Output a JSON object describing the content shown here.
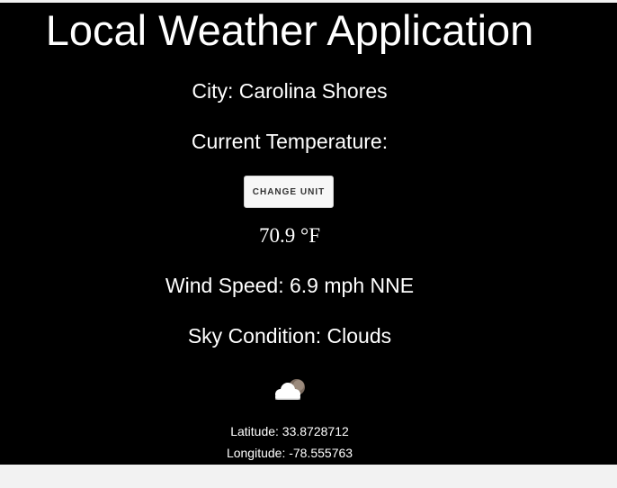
{
  "app": {
    "title": "Local Weather Application",
    "city": "City: Carolina Shores",
    "temperature_label": "Current Temperature:",
    "change_unit_label": "Change Unit",
    "temperature_value": "70.9 °F",
    "wind": "Wind Speed: 6.9 mph NNE",
    "sky": "Sky Condition: Clouds",
    "weather_icon": "cloud-with-moon-icon",
    "latitude": "Latitude: 33.8728712",
    "longitude": "Longitude: -78.555763"
  },
  "colors": {
    "background": "#000000",
    "text": "#ffffff",
    "page_bottom": "#f2f2f2",
    "button_bg": "#f7f7f7"
  }
}
